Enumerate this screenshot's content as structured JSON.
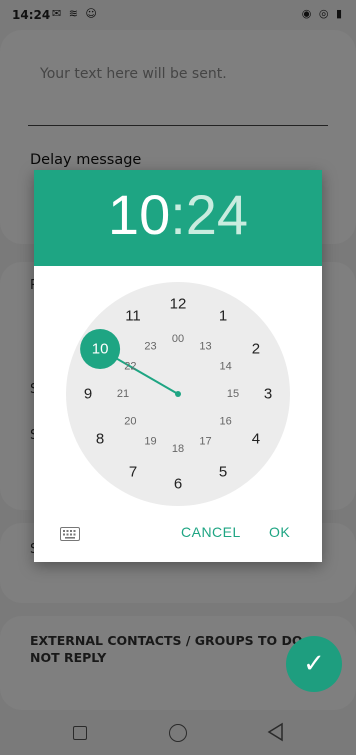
{
  "status": {
    "time": "14:24"
  },
  "screen": {
    "message_placeholder": "Your text here will be sent.",
    "delay_label": "Delay message",
    "external_label": "EXTERNAL CONTACTS / GROUPS TO DO NOT REPLY",
    "fab_icon": "check-icon"
  },
  "dialog": {
    "hour": "10",
    "colon": ":",
    "minute": "24",
    "outer_hours": [
      "12",
      "1",
      "2",
      "3",
      "4",
      "5",
      "6",
      "7",
      "8",
      "9",
      "10",
      "11"
    ],
    "inner_hours": [
      "00",
      "13",
      "14",
      "15",
      "16",
      "17",
      "18",
      "19",
      "20",
      "21",
      "22",
      "23"
    ],
    "selected_hour": "10",
    "cancel_label": "CANCEL",
    "ok_label": "OK",
    "keyboard_icon": "keyboard-icon",
    "accent": "#1ea583"
  }
}
